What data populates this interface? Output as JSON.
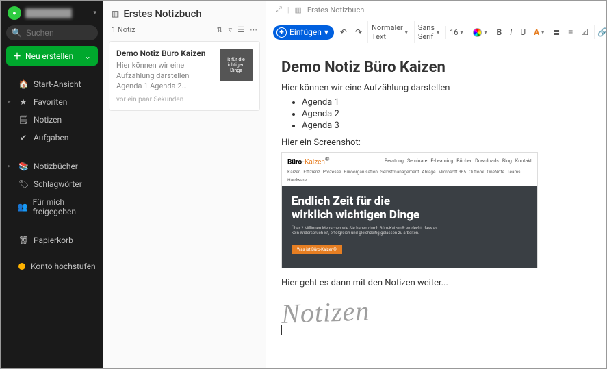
{
  "sidebar": {
    "user_name": "████████",
    "search_placeholder": "Suchen",
    "new_button": "Neu erstellen",
    "items": [
      {
        "icon": "🏠",
        "label": "Start-Ansicht",
        "caret": ""
      },
      {
        "icon": "★",
        "label": "Favoriten",
        "caret": "▸"
      },
      {
        "icon": "🗒",
        "label": "Notizen",
        "caret": ""
      },
      {
        "icon": "✔",
        "label": "Aufgaben",
        "caret": ""
      }
    ],
    "items2": [
      {
        "icon": "📚",
        "label": "Notizbücher",
        "caret": "▸"
      },
      {
        "icon": "🏷",
        "label": "Schlagwörter",
        "caret": ""
      },
      {
        "icon": "👥",
        "label": "Für mich freigegeben",
        "caret": ""
      }
    ],
    "items3": [
      {
        "icon": "🗑",
        "label": "Papierkorb",
        "caret": ""
      }
    ],
    "upgrade": "Konto hochstufen"
  },
  "list": {
    "title": "Erstes Notizbuch",
    "count": "1 Notiz",
    "card": {
      "title": "Demo Notiz Büro Kaizen",
      "snippet": "Hier können wir eine Aufzählung darstellen Agenda 1 Agenda 2…",
      "time": "vor ein paar Sekunden",
      "thumb_text": "it für die\nichtigen Dinge"
    }
  },
  "editor": {
    "breadcrumb_notebook": "Erstes Notizbuch",
    "toolbar": {
      "insert": "Einfügen",
      "style": "Normaler Text",
      "font": "Sans Serif",
      "size": "16"
    },
    "title": "Demo Notiz Büro Kaizen",
    "intro": "Hier können wir eine Aufzählung darstellen",
    "bullets": [
      "Agenda 1",
      "Agenda 2",
      "Agenda 3"
    ],
    "screenshot_label": "Hier ein Screenshot:",
    "shot": {
      "brand_a": "Büro-",
      "brand_b": "Kaizen",
      "nav1": [
        "Beratung",
        "Seminare",
        "E-Learning",
        "Bücher",
        "Downloads",
        "Blog",
        "Kontakt"
      ],
      "nav2": [
        "Kaizen",
        "Effizienz",
        "Prozesse",
        "Büroorganisation",
        "Selbstmanagement",
        "Ablage",
        "Microsoft 365",
        "Outlook",
        "OneNote",
        "Teams",
        "Hardware"
      ],
      "hero_l1": "Endlich Zeit für die",
      "hero_l2": "wirklich wichtigen Dinge",
      "hero_p": "Über 2 Millionen Menschen wie Sie haben durch Büro-Kaizen® entdeckt, dass es kein Widerspruch ist, erfolgreich und gleichzeitig gelassen zu arbeiten.",
      "cta": "Was ist Büro-Kaizen®"
    },
    "continue": "Hier geht es dann mit den Notizen weiter...",
    "handwriting": "Notizen"
  }
}
